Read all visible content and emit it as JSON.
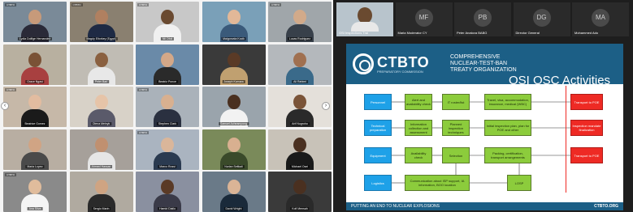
{
  "gallery": {
    "tiles": [
      {
        "name": "Lydia Dolfige Hernandez",
        "bg": "#7a8a98",
        "skin": "#c79a7a",
        "shirt": "#2a2a38",
        "banner": "CTBTO"
      },
      {
        "name": "Magdy Eltorkey (Egypt)",
        "bg": "#8a8070",
        "skin": "#b08060",
        "shirt": "#1e2a44",
        "banner": "CTBTO"
      },
      {
        "name": "Nii Ofoli",
        "bg": "#c8c8c8",
        "skin": "#6a4a30",
        "shirt": "#f0f0f0",
        "banner": "CTBTO"
      },
      {
        "name": "Malgorzata Kocik",
        "bg": "#7aa0b8",
        "skin": "#e2b898",
        "shirt": "#3a5a7a",
        "banner": ""
      },
      {
        "name": "Lucas Rodriguez",
        "bg": "#a0a6aa",
        "skin": "#d2aa8a",
        "shirt": "#38404a",
        "banner": "CTBTO"
      },
      {
        "name": "Grace Ngasi",
        "bg": "#b8b0a0",
        "skin": "#7a5236",
        "shirt": "#a84040",
        "banner": ""
      },
      {
        "name": "Peter Bari",
        "bg": "#c0bcb4",
        "skin": "#8a6040",
        "shirt": "#e8e8e8",
        "banner": ""
      },
      {
        "name": "Beatriz Ponce",
        "bg": "#6a8aa8",
        "skin": "#d4a888",
        "shirt": "#2a2a2a",
        "banner": ""
      },
      {
        "name": "Joseph Kamara",
        "bg": "#3a3a3a",
        "skin": "#5a3a26",
        "shirt": "#c0a070",
        "banner": ""
      },
      {
        "name": "Ali Rahimi",
        "bg": "#b4b8bc",
        "skin": "#a07050",
        "shirt": "#3a6a8a",
        "banner": ""
      },
      {
        "name": "Beatrice Gomez",
        "bg": "#c6b8a8",
        "skin": "#e2bca0",
        "shirt": "#1a1a1a",
        "banner": "CTBTO"
      },
      {
        "name": "Olena Melnyk",
        "bg": "#d8d2c8",
        "skin": "#e6c4a8",
        "shirt": "#5a5a6a",
        "banner": ""
      },
      {
        "name": "Stephen Clark",
        "bg": "#aab2ba",
        "skin": "#d8b090",
        "shirt": "#2a3040",
        "banner": "CTBTO"
      },
      {
        "name": "Samuel Acheampong",
        "bg": "#9aa4ac",
        "skin": "#4a3020",
        "shirt": "#f2f2f2",
        "banner": ""
      },
      {
        "name": "Arif Nugroho",
        "bg": "#e4e0da",
        "skin": "#7a5438",
        "shirt": "#2a2a2a",
        "banner": ""
      },
      {
        "name": "Maria Lopez",
        "bg": "#b8aea2",
        "skin": "#d0a484",
        "shirt": "#4a4a4a",
        "banner": ""
      },
      {
        "name": "Ahmed Hassan",
        "bg": "#a6a09a",
        "skin": "#c09070",
        "shirt": "#e6e6e6",
        "banner": ""
      },
      {
        "name": "Marco Rossi",
        "bg": "#aab4c0",
        "skin": "#dab69a",
        "shirt": "#2a3a50",
        "banner": "CTBTO"
      },
      {
        "name": "Nurlan Seitkali",
        "bg": "#7a8a5a",
        "skin": "#d8b090",
        "shirt": "#3a4a2a",
        "banner": ""
      },
      {
        "name": "Michael Osei",
        "bg": "#c8c2b8",
        "skin": "#4a3020",
        "shirt": "#1a1a1a",
        "banner": ""
      },
      {
        "name": "Ana Silva",
        "bg": "#8a8a8a",
        "skin": "#e0bc9c",
        "shirt": "#f4f4f4",
        "banner": "CTBTO"
      },
      {
        "name": "Sergio Marin",
        "bg": "#b0aaa0",
        "skin": "#cfa482",
        "shirt": "#2a2a2a",
        "banner": ""
      },
      {
        "name": "Hamid Diallo",
        "bg": "#8a90a0",
        "skin": "#5a3a26",
        "shirt": "#3a3a48",
        "banner": ""
      },
      {
        "name": "David Wright",
        "bg": "#6a7a88",
        "skin": "#dab496",
        "shirt": "#1a2a3a",
        "banner": ""
      },
      {
        "name": "Kofi Mensah",
        "bg": "#3a3a3a",
        "skin": "#4a3020",
        "shirt": "#2a2a2a",
        "banner": ""
      }
    ]
  },
  "share": {
    "strip": [
      {
        "label": "OSI Inspections Trai",
        "initials": "",
        "video": true
      },
      {
        "label": "Maria Moderator CY",
        "initials": "MF",
        "video": false
      },
      {
        "label": "Peter Anatova BABG",
        "initials": "PB",
        "video": false
      },
      {
        "label": "Director General",
        "initials": "DG",
        "video": false
      },
      {
        "label": "Mohammed Ado",
        "initials": "MA",
        "video": false
      }
    ],
    "slide": {
      "logo": "CTBTO",
      "logo_sub": "PREPARATORY COMMISSION",
      "org_name": "Comprehensive Nuclear-Test-Ban Treaty Organization",
      "title": "OSI OSC Activities",
      "colors": {
        "header": "#1c5f86",
        "blue": "#1ea1e8",
        "green": "#8ccc3c",
        "red": "#ee2a24"
      },
      "rows": [
        {
          "category": "Personnel",
          "steps": [
            "Alert and availability check",
            "IT roster/list"
          ],
          "mid": "Travel, visa, accommodation, insurance, medical (WBC)",
          "outcome": "Transport to POE"
        },
        {
          "category": "Technical preparation",
          "steps": [
            "Information collection and assessment",
            "Planned inspection techniques"
          ],
          "mid": "Initial inspection plan, plan for POE and other",
          "outcome": "Inspection mandate finalization"
        },
        {
          "category": "Equipment",
          "steps": [
            "Availability check",
            "Selection"
          ],
          "mid": "Packing, certification, transport arrangements",
          "outcome": "Transport to POE"
        },
        {
          "category": "Logistics",
          "steps": [
            "Communication about ISP support, IA information, BOO location",
            ""
          ],
          "mid": "LOSP",
          "outcome": ""
        }
      ],
      "footer_left": "PUTTING AN END TO NUCLEAR EXPLOSIONS",
      "footer_right": "CTBTO.ORG"
    }
  }
}
